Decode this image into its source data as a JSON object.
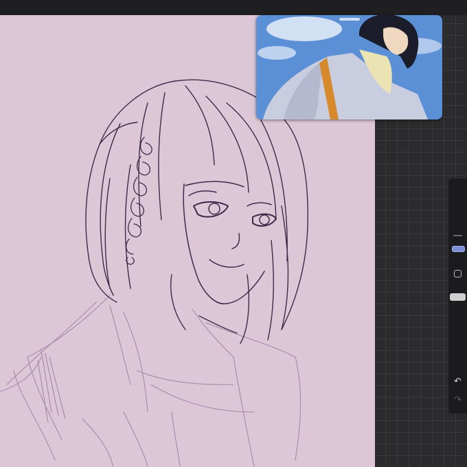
{
  "app": {
    "canvas_background": "#ddc6d6",
    "workspace_background": "#2b2b2d",
    "line_color": "#3c2a4a",
    "sketch_color": "#9a7fa0"
  },
  "reference_window": {
    "content": "reference-image",
    "sky_color": "#5b8fd6",
    "coat_color": "#c9cde0",
    "scarf_color": "#ece3b4",
    "hair_color": "#1b1d2a"
  },
  "sidebar": {
    "brush_size_icon": "brush-size-slider-icon",
    "modify_icon": "modify-square-icon",
    "opacity_icon": "opacity-slider-icon",
    "undo_icon": "undo-arrow-icon",
    "undo_glyph": "↶",
    "redo_icon": "redo-arrow-icon",
    "redo_glyph": "↷",
    "accent_color": "#7a8fd6"
  }
}
